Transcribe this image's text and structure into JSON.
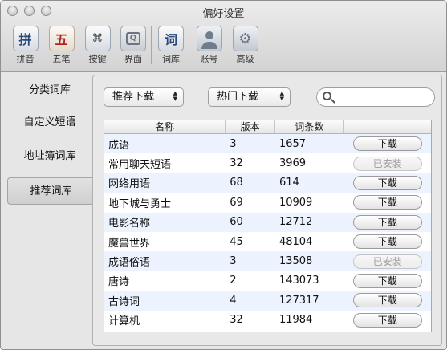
{
  "window": {
    "title": "偏好设置"
  },
  "toolbar": {
    "items": [
      {
        "label": "拼音",
        "glyph": "拼",
        "icon": "pinyin-icon"
      },
      {
        "label": "五笔",
        "glyph": "五",
        "icon": "wubi-icon"
      },
      {
        "label": "按键",
        "glyph": "⌘",
        "icon": "keyboard-shortcut-icon"
      },
      {
        "label": "界面",
        "glyph": "Q",
        "icon": "interface-icon"
      },
      {
        "label": "词库",
        "glyph": "词",
        "icon": "dictionary-icon"
      },
      {
        "label": "账号",
        "glyph": "",
        "icon": "account-icon"
      },
      {
        "label": "高级",
        "glyph": "⚙",
        "icon": "advanced-gear-icon"
      }
    ]
  },
  "sidebar": {
    "items": [
      {
        "label": "分类词库"
      },
      {
        "label": "自定义短语"
      },
      {
        "label": "地址簿词库"
      },
      {
        "label": "推荐词库",
        "selected": true
      }
    ]
  },
  "filters": {
    "recommend": "推荐下载",
    "popular": "热门下载",
    "search_value": ""
  },
  "table": {
    "headers": [
      "名称",
      "版本",
      "词条数",
      ""
    ],
    "rows": [
      {
        "name": "成语",
        "version": "3",
        "count": "1657",
        "action": "下载",
        "installed": false
      },
      {
        "name": "常用聊天短语",
        "version": "32",
        "count": "3969",
        "action": "已安装",
        "installed": true
      },
      {
        "name": "网络用语",
        "version": "68",
        "count": "614",
        "action": "下载",
        "installed": false
      },
      {
        "name": "地下城与勇士",
        "version": "69",
        "count": "10909",
        "action": "下载",
        "installed": false
      },
      {
        "name": "电影名称",
        "version": "60",
        "count": "12712",
        "action": "下载",
        "installed": false
      },
      {
        "name": "魔兽世界",
        "version": "45",
        "count": "48104",
        "action": "下载",
        "installed": false
      },
      {
        "name": "成语俗语",
        "version": "3",
        "count": "13508",
        "action": "已安装",
        "installed": true
      },
      {
        "name": "唐诗",
        "version": "2",
        "count": "143073",
        "action": "下载",
        "installed": false
      },
      {
        "name": "古诗词",
        "version": "4",
        "count": "127317",
        "action": "下载",
        "installed": false
      },
      {
        "name": "计算机",
        "version": "32",
        "count": "11984",
        "action": "下载",
        "installed": false
      }
    ]
  }
}
